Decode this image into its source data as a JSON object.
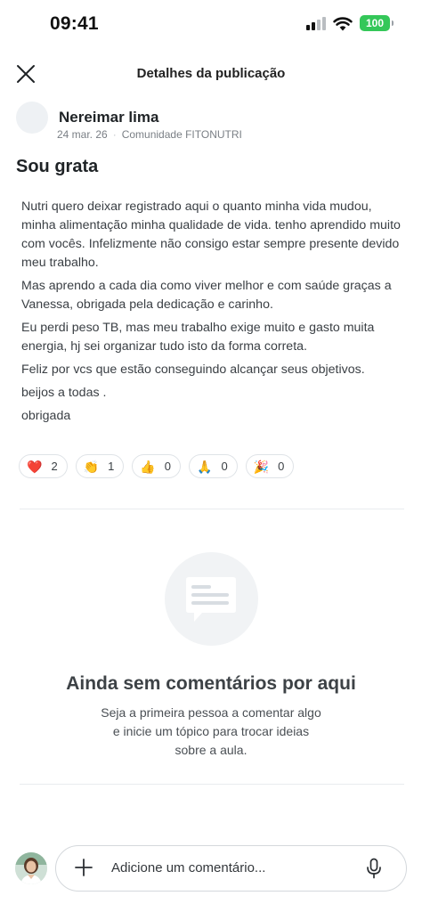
{
  "status_bar": {
    "time": "09:41",
    "battery": "100"
  },
  "header": {
    "title": "Detalhes da publicação",
    "close_icon": "close-icon"
  },
  "author": {
    "name": "Nereimar lima",
    "date": "24 mar. 26",
    "community": "Comunidade FITONUTRI"
  },
  "post": {
    "title": "Sou grata",
    "paragraphs": [
      "Nutri quero deixar registrado aqui o quanto minha vida mudou, minha alimentação minha qualidade de vida. tenho aprendido muito com vocês. Infelizmente não consigo estar sempre presente devido meu trabalho.",
      "Mas aprendo a cada dia como viver melhor e com saúde graças a Vanessa, obrigada pela dedicação e carinho.",
      "Eu perdi peso TB, mas meu trabalho exige muito e gasto muita energia, hj sei organizar tudo isto da forma correta.",
      "Feliz por vcs que estão conseguindo alcançar seus objetivos.",
      "beijos a todas .",
      "obrigada"
    ]
  },
  "reactions": [
    {
      "emoji": "❤️",
      "icon": "heart-icon",
      "count": "2"
    },
    {
      "emoji": "👏",
      "icon": "clapping-hands-icon",
      "count": "1"
    },
    {
      "emoji": "👍",
      "icon": "thumbs-up-icon",
      "count": "0"
    },
    {
      "emoji": "🙏",
      "icon": "praying-hands-icon",
      "count": "0"
    },
    {
      "emoji": "🎉",
      "icon": "party-popper-icon",
      "count": "0"
    }
  ],
  "comments_empty": {
    "icon": "chat-bubble-icon",
    "title": "Ainda sem comentários por aqui",
    "subtitle_lines": [
      "Seja a primeira pessoa a comentar algo",
      "e inicie um tópico para trocar ideias",
      "sobre a aula."
    ]
  },
  "comment_bar": {
    "placeholder": "Adicione um comentário...",
    "plus_icon": "plus-icon",
    "mic_icon": "microphone-icon"
  },
  "colors": {
    "accent_green": "#34c759",
    "divider": "#e9ecef",
    "muted_text": "#7a7f85"
  }
}
